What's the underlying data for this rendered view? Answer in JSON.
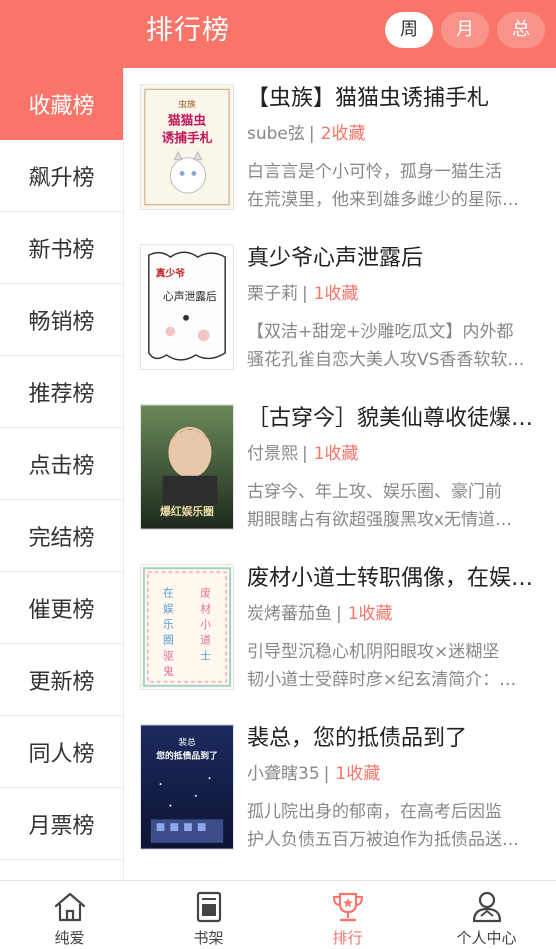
{
  "header": {
    "title": "排行榜",
    "periods": [
      "周",
      "月",
      "总"
    ],
    "active_period": "周"
  },
  "sidebar": {
    "items": [
      {
        "label": "收藏榜",
        "active": true
      },
      {
        "label": "飙升榜",
        "active": false
      },
      {
        "label": "新书榜",
        "active": false
      },
      {
        "label": "畅销榜",
        "active": false
      },
      {
        "label": "推荐榜",
        "active": false
      },
      {
        "label": "点击榜",
        "active": false
      },
      {
        "label": "完结榜",
        "active": false
      },
      {
        "label": "催更榜",
        "active": false
      },
      {
        "label": "更新榜",
        "active": false
      },
      {
        "label": "同人榜",
        "active": false
      },
      {
        "label": "月票榜",
        "active": false
      }
    ]
  },
  "books": [
    {
      "title": "【虫族】猫猫虫诱捕手札",
      "author": "sube弦",
      "favorites": "2收藏",
      "desc_line1": "白言言是个小可怜，孤身一猫生活",
      "desc_line2": "在荒漠里，他来到雄多雌少的星际…",
      "cover_text": "猫猫虫诱捕手札",
      "cover_tag": "虫族"
    },
    {
      "title": "真少爷心声泄露后",
      "author": "栗子莉",
      "favorites": "1收藏",
      "desc_line1": "【双洁+甜宠+沙雕吃瓜文】内外都",
      "desc_line2": "骚花孔雀自恋大美人攻VS香香软软…",
      "cover_text": "心声泄露后",
      "cover_tag": "真少爷"
    },
    {
      "title": "［古穿今］貌美仙尊收徒爆红娱乐圈",
      "author": "付景熙",
      "favorites": "1收藏",
      "desc_line1": "古穿今、年上攻、娱乐圈、豪门前",
      "desc_line2": "期眼瞎占有欲超强腹黑攻x无情道…",
      "cover_text": "爆红娱乐圈",
      "cover_tag": ""
    },
    {
      "title": "废材小道士转职偶像，在娱乐圈驱鬼",
      "author": "炭烤蕃茄鱼",
      "favorites": "1收藏",
      "desc_line1": "引导型沉稳心机阴阳眼攻×迷糊坚",
      "desc_line2": "韧小道士受薛时彦×纪玄清简介：…",
      "cover_text": "",
      "cover_tag": ""
    },
    {
      "title": "裴总，您的抵债品到了",
      "author": "小聋瞎35",
      "favorites": "1收藏",
      "desc_line1": "孤儿院出身的郁南，在高考后因监",
      "desc_line2": "护人负债五百万被迫作为抵债品送…",
      "cover_text": "您的抵债品到了",
      "cover_tag": "裴总"
    }
  ],
  "bottom_nav": {
    "items": [
      {
        "label": "纯爱",
        "icon": "house-icon",
        "active": false
      },
      {
        "label": "书架",
        "icon": "bookshelf-icon",
        "active": false
      },
      {
        "label": "排行",
        "icon": "trophy-icon",
        "active": true
      },
      {
        "label": "个人中心",
        "icon": "user-icon",
        "active": false
      }
    ]
  },
  "colors": {
    "accent": "#f9756a",
    "text": "#333333",
    "muted": "#888888"
  }
}
